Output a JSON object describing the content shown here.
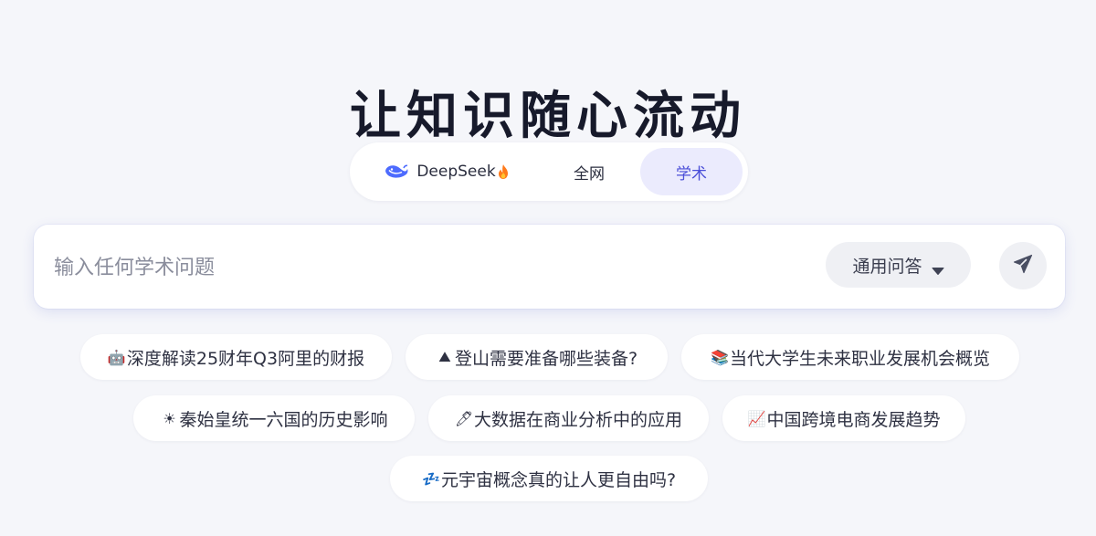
{
  "hero": {
    "title": "让知识随心流动"
  },
  "tabs": [
    {
      "label": "DeepSeek",
      "icon": "whale-icon",
      "badge_icon": "fire-icon",
      "active": false
    },
    {
      "label": "全网",
      "active": false
    },
    {
      "label": "学术",
      "active": true
    }
  ],
  "search": {
    "placeholder": "输入任何学术问题",
    "value": "",
    "mode_label": "通用问答",
    "mode_icon": "caret-down-icon",
    "send_icon": "paper-plane-icon"
  },
  "suggestions": [
    {
      "emoji": "🤖",
      "icon": "robot-icon",
      "text": "深度解读25财年Q3阿里的财报"
    },
    {
      "emoji": "⛰",
      "icon": "mountain-icon",
      "text": "登山需要准备哪些装备?"
    },
    {
      "emoji": "📚",
      "icon": "books-icon",
      "text": "当代大学生未来职业发展机会概览"
    },
    {
      "emoji": "☀",
      "icon": "sun-icon",
      "text": "秦始皇统一六国的历史影响"
    },
    {
      "emoji": "🖊",
      "icon": "pencil-icon",
      "text": "大数据在商业分析中的应用"
    },
    {
      "emoji": "📈",
      "icon": "chart-up-icon",
      "text": "中国跨境电商发展趋势"
    },
    {
      "emoji": "💤",
      "icon": "zzz-icon",
      "text": "元宇宙概念真的让人更自由吗?"
    }
  ],
  "colors": {
    "background": "#f5f6fa",
    "active_tab_bg": "#ebebfd",
    "active_tab_text": "#4b4fd8",
    "whale": "#4d6bfe",
    "fire": "#ff7a1a"
  }
}
